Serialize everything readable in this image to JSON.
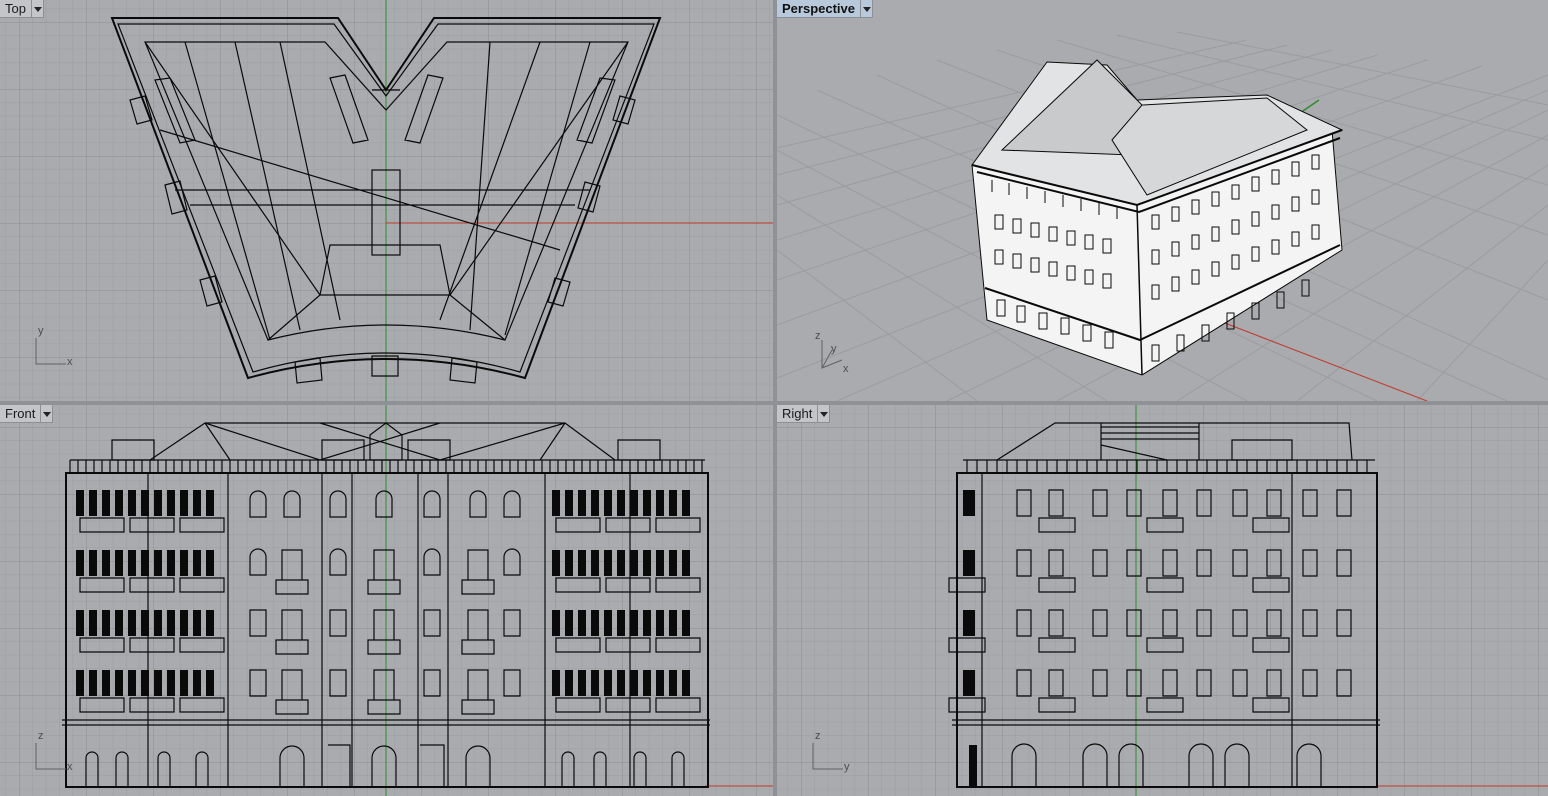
{
  "viewports": {
    "top": {
      "name": "Top",
      "axis_a": "y",
      "axis_b": "x"
    },
    "perspective": {
      "name": "Perspective",
      "axis_a": "z",
      "axis_b": "y",
      "axis_c": "x"
    },
    "front": {
      "name": "Front",
      "axis_a": "z",
      "axis_b": "x"
    },
    "right": {
      "name": "Right",
      "axis_a": "z",
      "axis_b": "y"
    }
  },
  "colors": {
    "viewport_bg": "#a9abae",
    "grid_minor": "#9c9ea2",
    "grid_major": "#8a8d91",
    "axis_x": "#c0392b",
    "axis_y": "#2e8b2e",
    "wire": "#0a0a0a",
    "active_tab": "#b9c9dc"
  },
  "icons": [
    "viewport-menu-arrow-icon"
  ]
}
